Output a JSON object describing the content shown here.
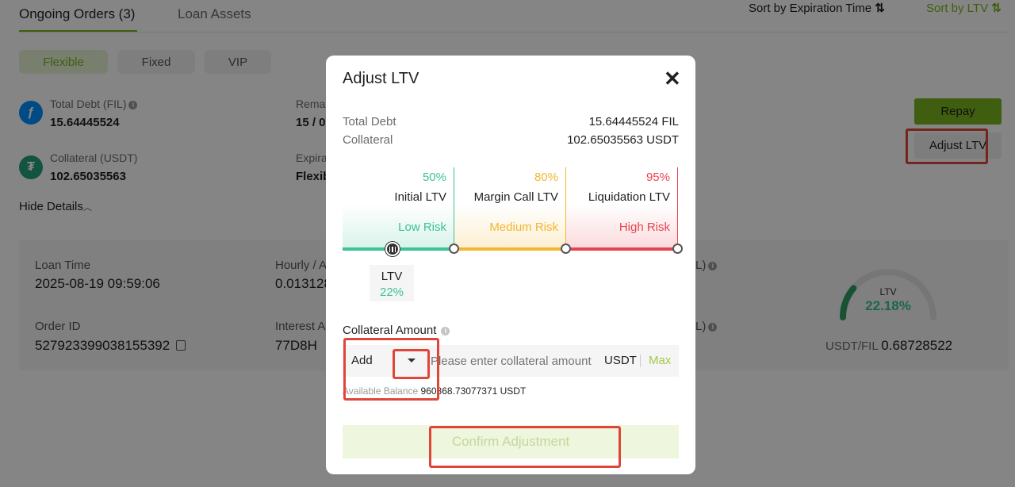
{
  "tabs": [
    {
      "label": "Ongoing Orders (3)"
    },
    {
      "label": "Loan Assets"
    }
  ],
  "sort": {
    "expiration_label": "Sort by Expiration Time",
    "ltv_label": "Sort by LTV",
    "arrow_glyph": "⇅"
  },
  "filters": [
    {
      "label": "Flexible"
    },
    {
      "label": "Fixed"
    },
    {
      "label": "VIP"
    }
  ],
  "order": {
    "total_debt_label": "Total Debt (FIL)",
    "total_debt_value": "15.64445524",
    "collateral_label": "Collateral (USDT)",
    "collateral_value": "102.65035563",
    "remaining_label": "Rema",
    "remaining_value": "15 / 0",
    "expiration_label": "Expira",
    "expiration_value": "Flexib",
    "hide_details": "Hide Details",
    "repay_label": "Repay",
    "adjust_label": "Adjust LTV"
  },
  "details": {
    "loan_time_label": "Loan Time",
    "loan_time_value": "2025-08-19 09:59:06",
    "order_id_label": "Order ID",
    "order_id_value": "527923399038155392",
    "hourly_label": "Hourly / A",
    "hourly_value": "0.013128",
    "interest_label": "Interest A",
    "interest_value": "77D8H",
    "right_label_1": "L)",
    "right_label_2": "L)",
    "ltv_gauge_label": "LTV",
    "ltv_gauge_value": "22.18%",
    "ltv_gauge_fraction": 0.2218,
    "pair_label": "USDT/FIL",
    "pair_value": "0.68728522"
  },
  "modal": {
    "title": "Adjust LTV",
    "total_debt_label": "Total Debt",
    "total_debt_value": "15.64445524 FIL",
    "collateral_label": "Collateral",
    "collateral_value": "102.65035563 USDT",
    "zones": [
      {
        "pct": "50%",
        "name": "Initial LTV",
        "risk": "Low Risk",
        "color": "#3cc296"
      },
      {
        "pct": "80%",
        "name": "Margin Call LTV",
        "risk": "Medium Risk",
        "color": "#f2b630"
      },
      {
        "pct": "95%",
        "name": "Liquidation LTV",
        "risk": "High Risk",
        "color": "#e8444f"
      }
    ],
    "current_ltv_label": "LTV",
    "current_ltv_value": "22%",
    "collateral_amount_label": "Collateral Amount",
    "mode_value": "Add",
    "input_placeholder": "Please enter collateral amount",
    "unit": "USDT",
    "max_label": "Max",
    "available_label": "Available Balance",
    "available_value": "960868.73077371 USDT",
    "confirm_label": "Confirm Adjustment"
  }
}
